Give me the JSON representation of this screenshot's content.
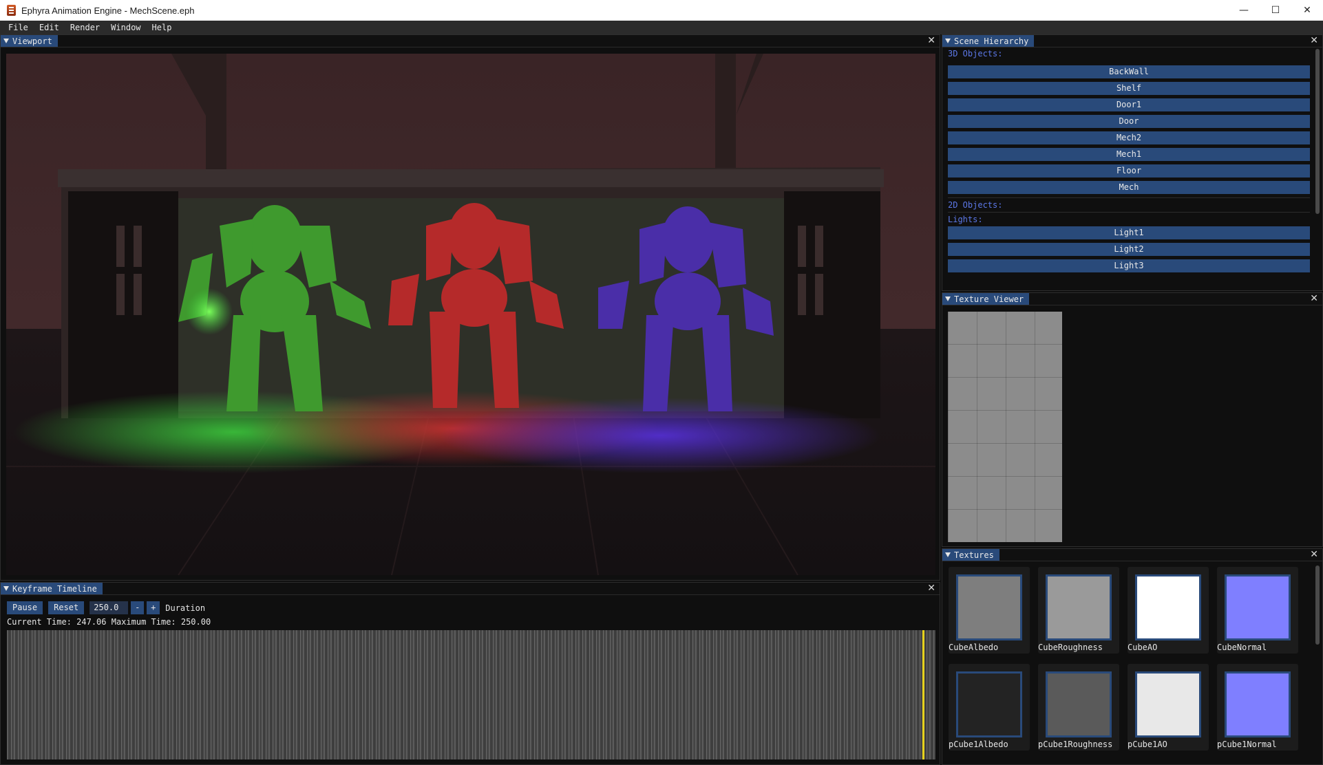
{
  "window": {
    "title": "Ephyra Animation Engine - MechScene.eph",
    "controls": {
      "minimize": "—",
      "maximize": "☐",
      "close": "✕"
    }
  },
  "menu": [
    "File",
    "Edit",
    "Render",
    "Window",
    "Help"
  ],
  "viewport": {
    "title": "Viewport",
    "close": "✕"
  },
  "timeline": {
    "title": "Keyframe Timeline",
    "close": "✕",
    "pause_label": "Pause",
    "reset_label": "Reset",
    "duration_value": "250.0",
    "minus_label": "-",
    "plus_label": "+",
    "duration_label": "Duration",
    "status": "Current Time: 247.06 Maximum Time: 250.00",
    "progress": 0.988,
    "cursor_color": "#e6d21c"
  },
  "hierarchy": {
    "title": "Scene Hierarchy",
    "close": "✕",
    "objects3d_label": "3D Objects:",
    "objects3d": [
      "BackWall",
      "Shelf",
      "Door1",
      "Door",
      "Mech2",
      "Mech1",
      "Floor",
      "Mech"
    ],
    "objects2d_label": "2D Objects:",
    "lights_label": "Lights:",
    "lights": [
      "Light1",
      "Light2",
      "Light3"
    ]
  },
  "texture_viewer": {
    "title": "Texture Viewer",
    "close": "✕"
  },
  "textures": {
    "title": "Textures",
    "close": "✕",
    "items": [
      {
        "name": "CubeAlbedo",
        "color": "#7e7e7e"
      },
      {
        "name": "CubeRoughness",
        "color": "#9a9a9a"
      },
      {
        "name": "CubeAO",
        "color": "#ffffff"
      },
      {
        "name": "CubeNormal",
        "color": "#7f7fff"
      },
      {
        "name": "pCube1Albedo",
        "color": "#232323"
      },
      {
        "name": "pCube1Roughness",
        "color": "#5a5a5a"
      },
      {
        "name": "pCube1AO",
        "color": "#e8e8e8"
      },
      {
        "name": "pCube1Normal",
        "color": "#7f7fff"
      }
    ]
  },
  "colors": {
    "accent": "#294a7a",
    "section_label": "#5c78e8",
    "light_green": "#3cc83c",
    "light_red": "#d23232",
    "light_blue": "#5a32e6"
  }
}
